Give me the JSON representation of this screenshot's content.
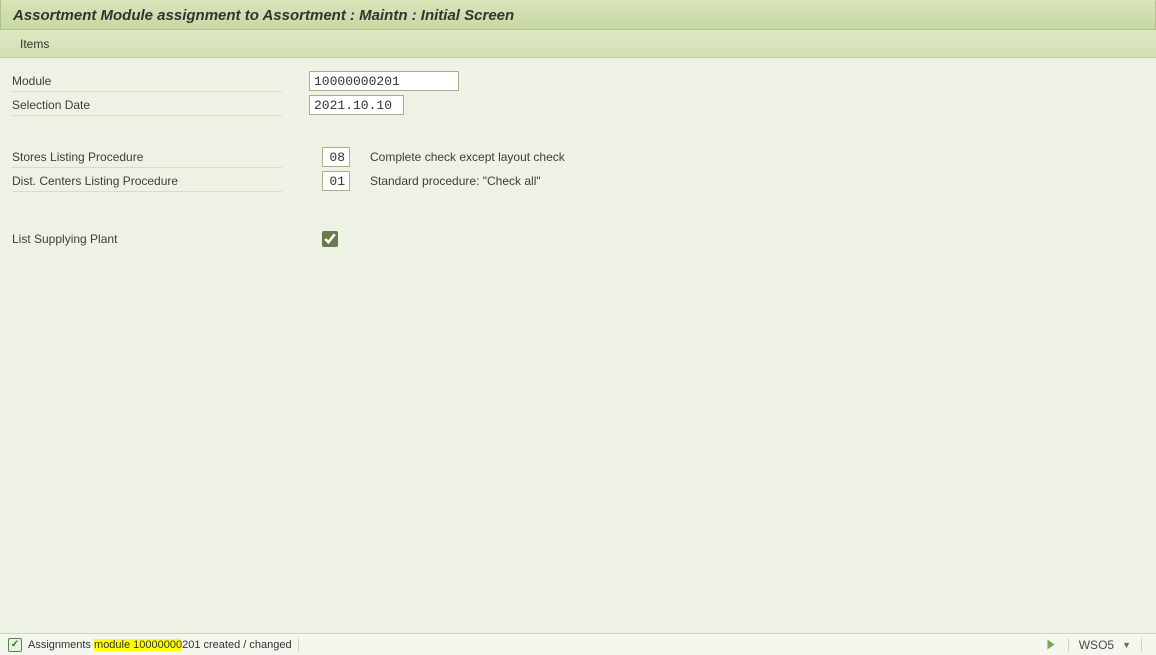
{
  "title": "Assortment Module assignment to  Assortment : Maintn : Initial Screen",
  "subbar": {
    "items_label": "Items"
  },
  "fields": {
    "module": {
      "label": "Module",
      "value": "10000000201"
    },
    "selection_date": {
      "label": "Selection Date",
      "value": "2021.10.10"
    },
    "stores": {
      "label": "Stores Listing Procedure",
      "value": "08",
      "desc": "Complete check except layout check"
    },
    "dist": {
      "label": "Dist. Centers Listing Procedure",
      "value": "01",
      "desc": "Standard procedure: \"Check all\""
    },
    "list_supplying": {
      "label": "List Supplying Plant",
      "checked": true
    }
  },
  "status": {
    "message_prefix": "Assignments ",
    "message_highlight": "module 10000000",
    "message_suffix": "201 created / changed",
    "tcode": "WSO5"
  }
}
